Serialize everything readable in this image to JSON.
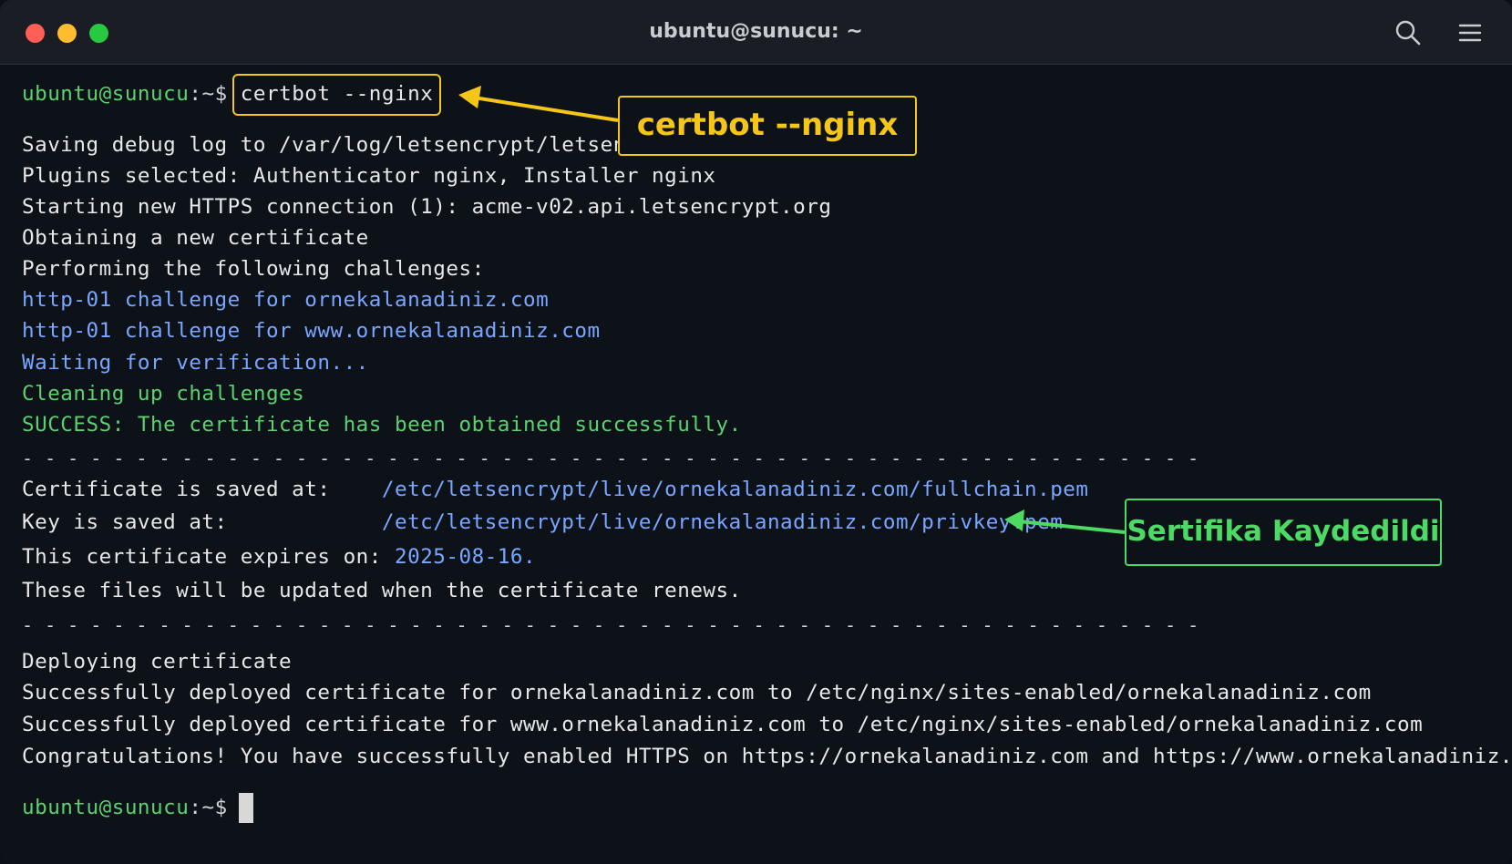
{
  "window": {
    "title": "ubuntu@sunucu: ~",
    "traffic_lights": [
      "#ff5f57",
      "#febc2e",
      "#28c840"
    ],
    "icons": [
      "search-icon",
      "menu-icon"
    ]
  },
  "prompt": {
    "user_host": "ubuntu@sunucu",
    "sep": ":",
    "path": "~",
    "symbol": "$"
  },
  "command": "certbot --nginx",
  "output": {
    "l1": "Saving debug log to /var/log/letsencrypt/letsencryp",
    "l2": "Plugins selected: Authenticator nginx, Installer nginx",
    "l3": "Starting new HTTPS connection (1): acme-v02.api.letsencrypt.org",
    "l4": "Obtaining a new certificate",
    "l5": "Performing the following challenges:",
    "l6": "http-01 challenge for ornekalanadiniz.com",
    "l7": "http-01 challenge for www.ornekalanadiniz.com",
    "l8": "Waiting for verification...",
    "l9": "Cleaning up challenges",
    "l10": "SUCCESS: The certificate has been obtained successfully.",
    "sep": "- - - - - - - - - - - - - - - - - - - - - - - - - - - - - - - - - - - - - - - - - - - - - - - - - - - -",
    "cert_label": "Certificate is saved at:    ",
    "cert_path": "/etc/letsencrypt/live/ornekalanadiniz.com/fullchain.pem",
    "key_label": "Key is saved at:            ",
    "key_path": "/etc/letsencrypt/live/ornekalanadiniz.com/privkey.pem",
    "expires_label": "This certificate expires on: ",
    "expires_date": "2025-08-16.",
    "renew": "These files will be updated when the certificate renews.",
    "deploying": "Deploying certificate",
    "deploy1": "Successfully deployed certificate for ornekalanadiniz.com to /etc/nginx/sites-enabled/ornekalanadiniz.com",
    "deploy2": "Successfully deployed certificate for www.ornekalanadiniz.com to /etc/nginx/sites-enabled/ornekalanadiniz.com",
    "congrats": "Congratulations! You have successfully enabled HTTPS on https://ornekalanadiniz.com and https://www.ornekalanadiniz.com"
  },
  "callouts": {
    "command": "certbot --nginx",
    "saved": "Sertifika Kaydedildi"
  },
  "colors": {
    "prompt_green": "#5bd16f",
    "info_blue": "#7aa6ff",
    "callout_yellow": "#f5c518",
    "callout_green": "#4cd964"
  }
}
